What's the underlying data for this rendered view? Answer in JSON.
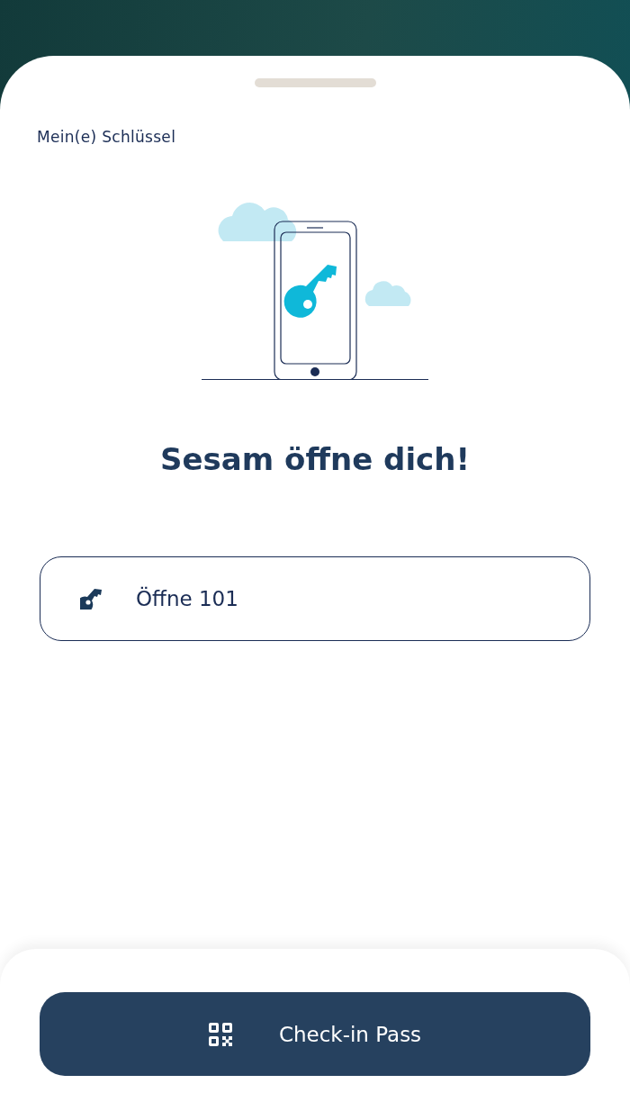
{
  "sheet": {
    "title": "Mein(e) Schlüssel"
  },
  "heading": "Sesam öffne dich!",
  "keys": [
    {
      "label": "Öffne 101"
    }
  ],
  "footer": {
    "button": "Check-in Pass"
  }
}
